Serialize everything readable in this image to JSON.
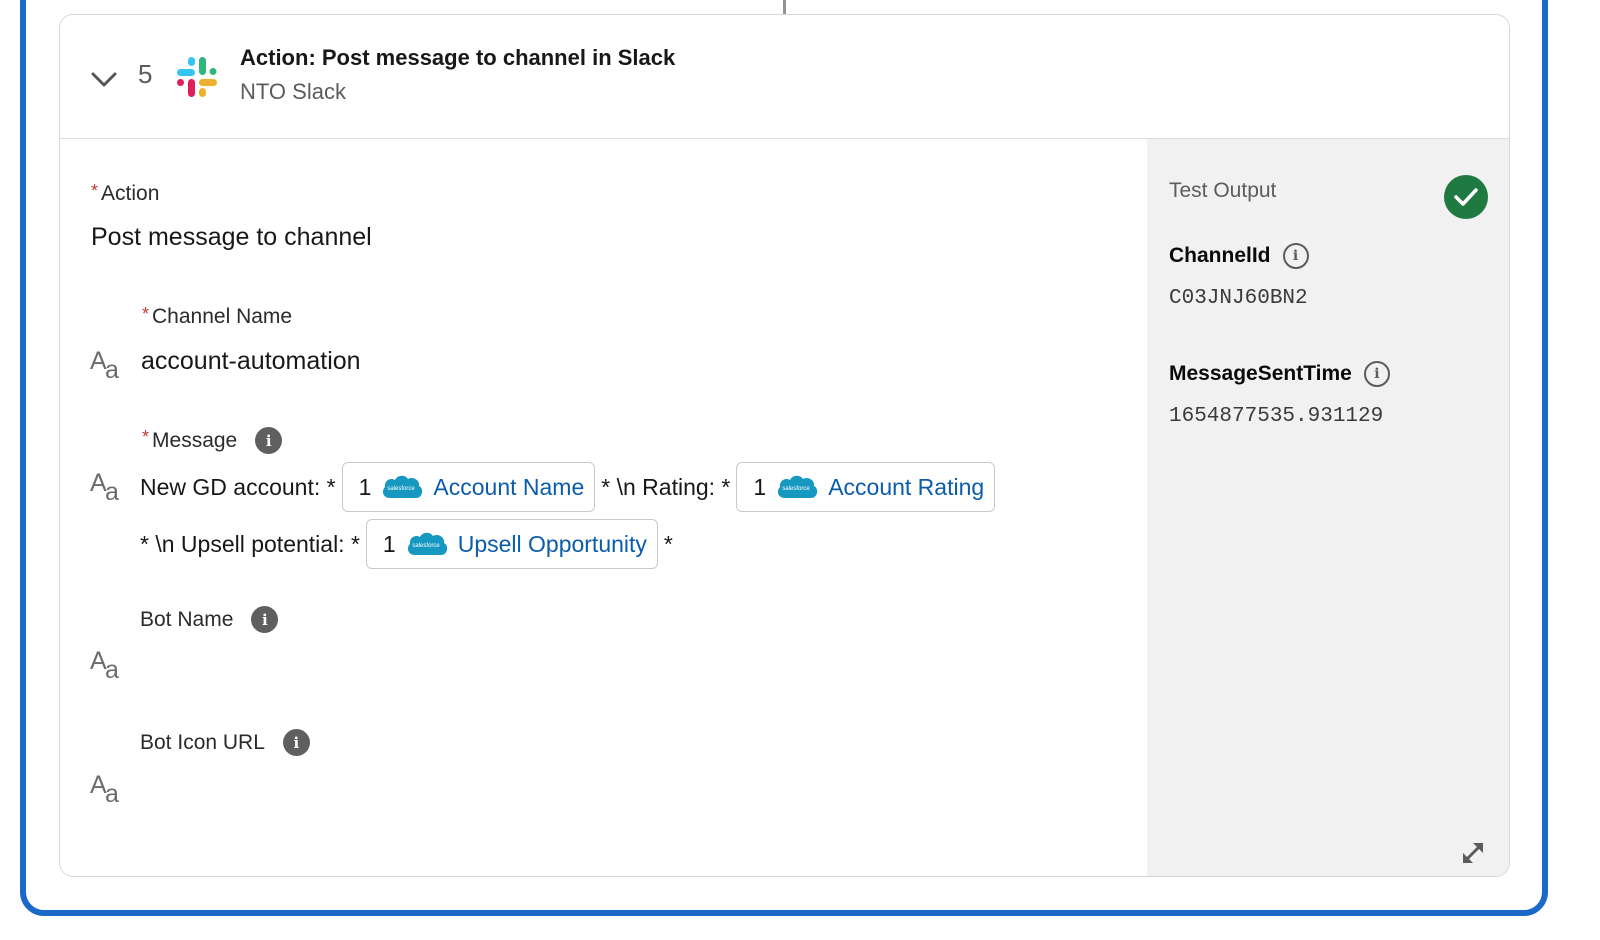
{
  "step": {
    "number": "5",
    "title": "Action: Post message to channel in Slack",
    "subtitle": "NTO Slack",
    "icon": "slack-logo",
    "expanded": true
  },
  "form": {
    "action": {
      "label": "Action",
      "required": true,
      "value": "Post message to channel"
    },
    "channel_name": {
      "label": "Channel Name",
      "required": true,
      "type_icon": "text-type-icon",
      "value": "account-automation"
    },
    "message": {
      "label": "Message",
      "required": true,
      "has_info": true,
      "type_icon": "text-type-icon",
      "segments": {
        "text1": "New GD account: *",
        "pill1": {
          "step": "1",
          "source_icon": "salesforce-cloud",
          "label": "Account Name"
        },
        "text2": "* \\n Rating: *",
        "pill2": {
          "step": "1",
          "source_icon": "salesforce-cloud",
          "label": "Account Rating"
        },
        "text3": "* \\n Upsell potential: *",
        "pill3": {
          "step": "1",
          "source_icon": "salesforce-cloud",
          "label": "Upsell Opportunity"
        },
        "text4": "*"
      }
    },
    "bot_name": {
      "label": "Bot Name",
      "required": false,
      "has_info": true,
      "type_icon": "text-type-icon",
      "value": ""
    },
    "bot_icon_url": {
      "label": "Bot Icon URL",
      "required": false,
      "has_info": true,
      "type_icon": "text-type-icon",
      "value": ""
    }
  },
  "test_output": {
    "title": "Test Output",
    "status": "success",
    "fields": [
      {
        "key": "ChannelId",
        "value": "C03JNJ60BN2"
      },
      {
        "key": "MessageSentTime",
        "value": "1654877535.931129"
      }
    ]
  },
  "icons": {
    "required_marker": "*",
    "info_glyph": "i",
    "type_big": "A",
    "type_small": "a",
    "salesforce_text": "salesforce"
  },
  "colors": {
    "frame_blue": "#1b6ac9",
    "link_blue": "#0b5cab",
    "success_green": "#1f7a41",
    "required_red": "#c23934",
    "panel_gray": "#f1f1f1",
    "salesforce_blue": "#1798c1"
  }
}
